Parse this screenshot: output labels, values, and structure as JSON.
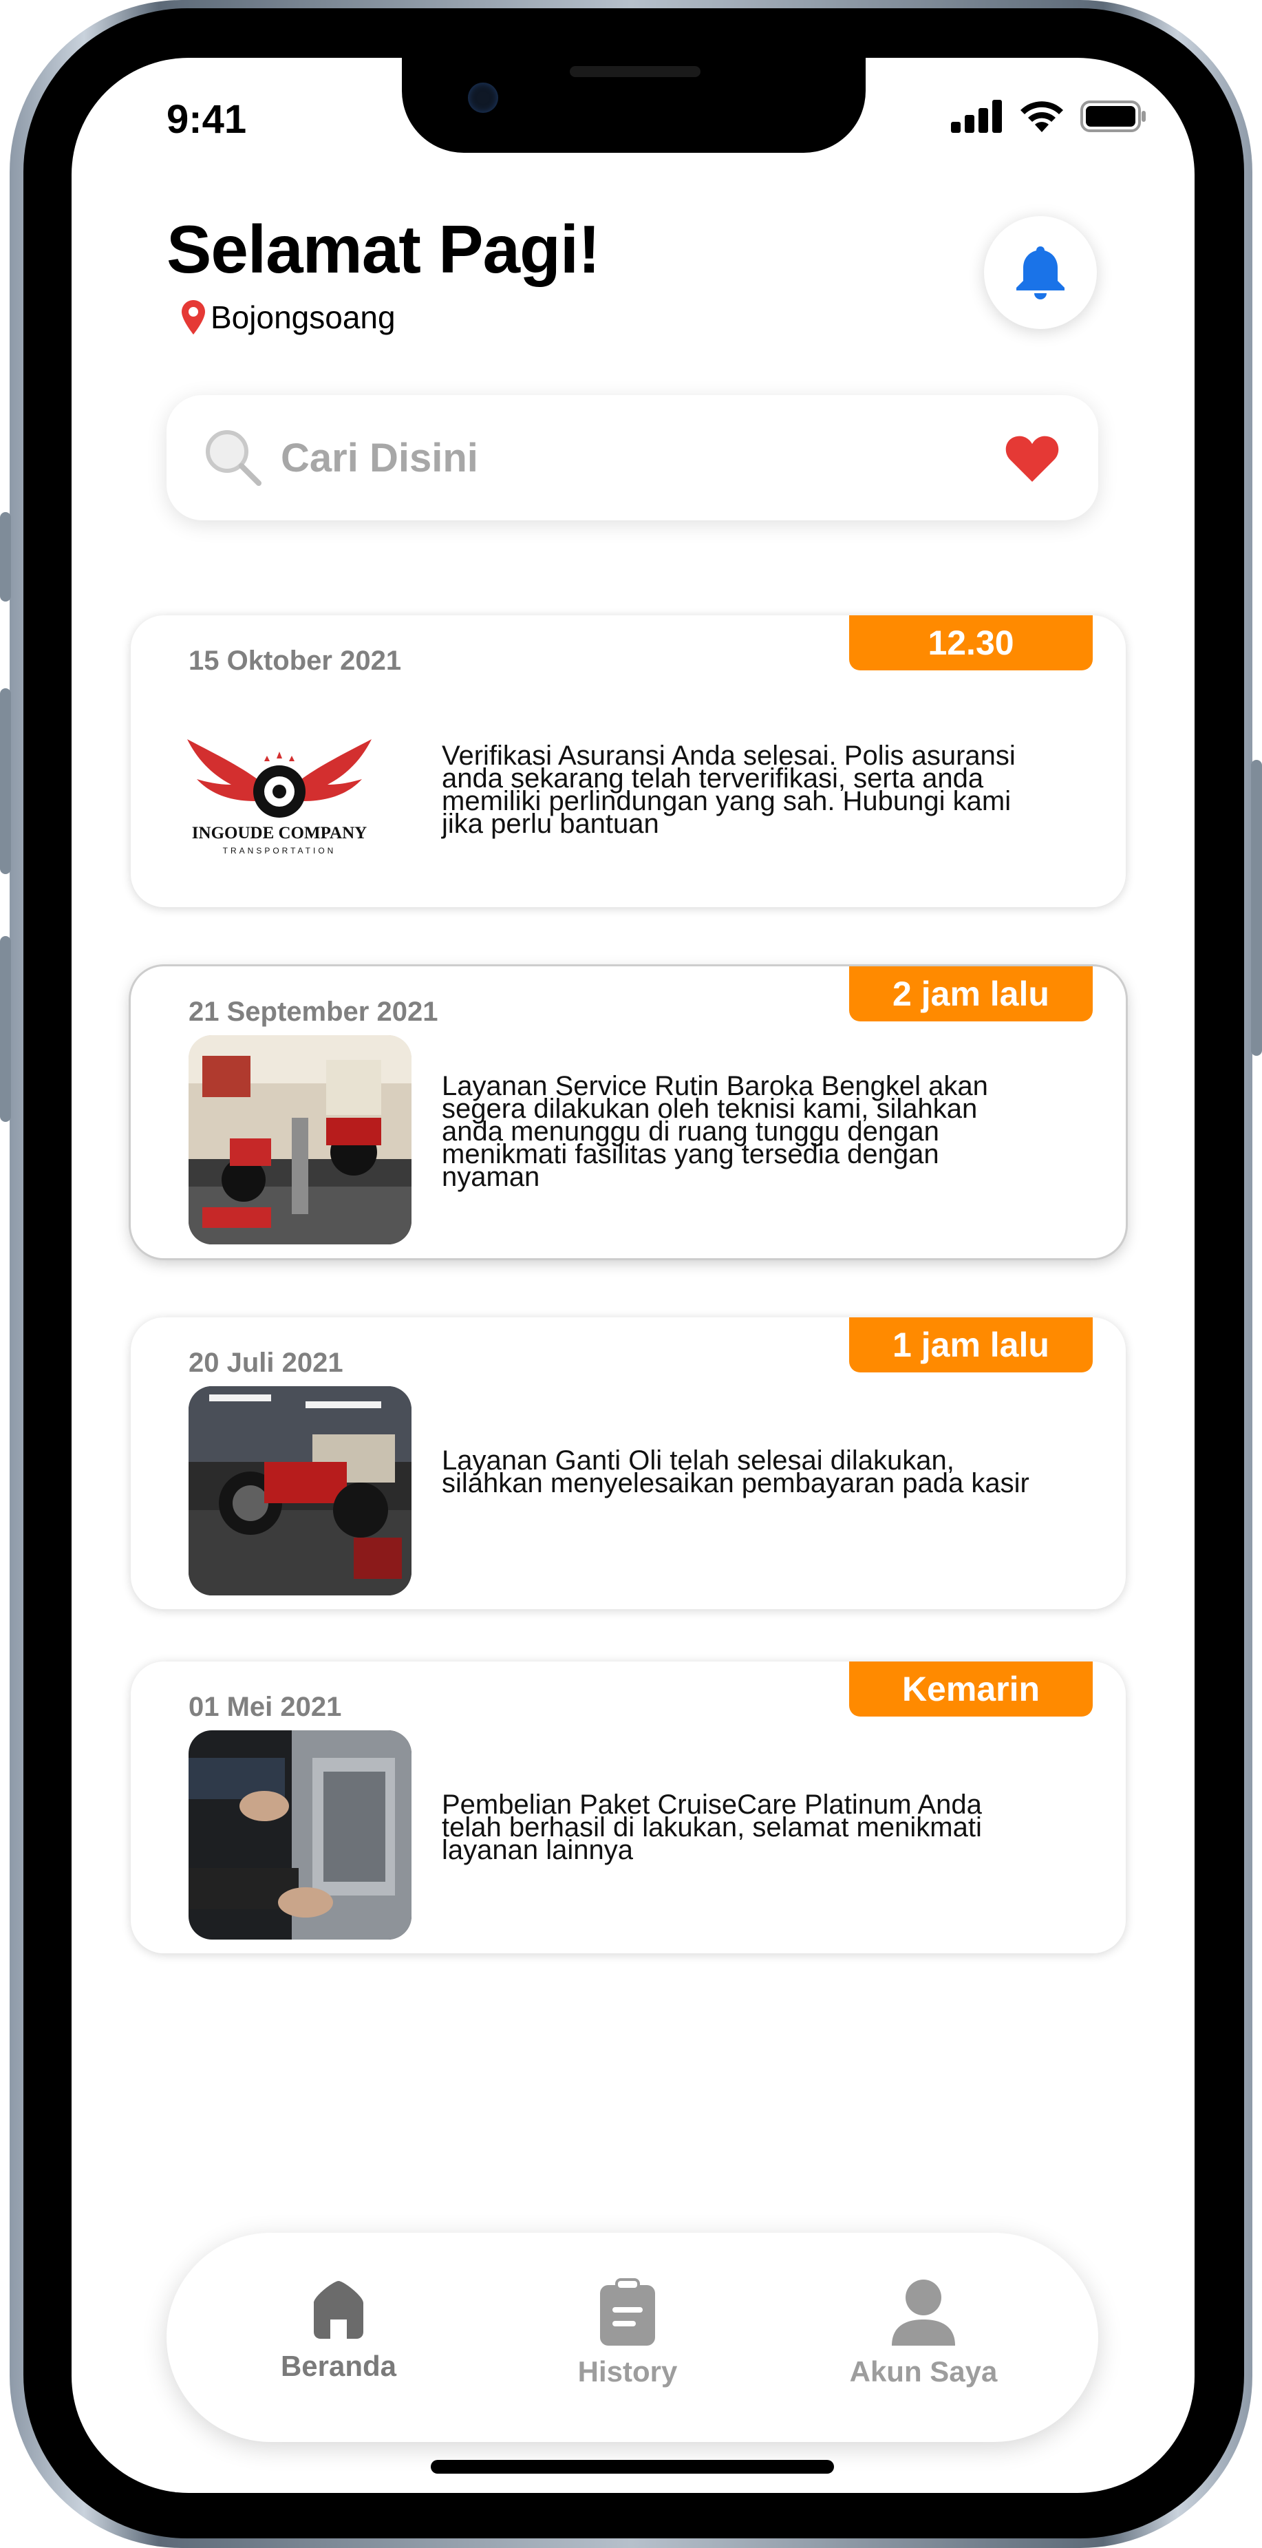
{
  "status_bar": {
    "time": "9:41"
  },
  "header": {
    "greeting": "Selamat Pagi!",
    "location": "Bojongsoang"
  },
  "search": {
    "placeholder": "Cari Disini"
  },
  "notifications": [
    {
      "date": "15 Oktober 2021",
      "badge": "12.30",
      "text": "Verifikasi Asuransi Anda selesai. Polis asuransi anda sekarang telah terverifikasi, serta anda memiliki perlindungan yang sah. Hubungi kami jika perlu bantuan",
      "logo_text": "INGOUDE COMPANY",
      "logo_subtext": "TRANSPORTATION"
    },
    {
      "date": "21 September 2021",
      "badge": "2 jam lalu",
      "text": "Layanan Service Rutin Baroka Bengkel akan segera dilakukan oleh teknisi kami, silahkan anda menunggu di ruang tunggu dengan menikmati fasilitas yang tersedia dengan nyaman"
    },
    {
      "date": "20 Juli 2021",
      "badge": "1 jam lalu",
      "text": "Layanan Ganti Oli telah selesai dilakukan, silahkan menyelesaikan pembayaran pada kasir"
    },
    {
      "date": "01 Mei 2021",
      "badge": "Kemarin",
      "text": "Pembelian Paket CruiseCare Platinum Anda telah berhasil di lakukan, selamat menikmati layanan lainnya"
    }
  ],
  "tabbar": {
    "tabs": [
      {
        "label": "Beranda",
        "icon": "home-icon"
      },
      {
        "label": "History",
        "icon": "clipboard-icon"
      },
      {
        "label": "Akun Saya",
        "icon": "user-icon"
      }
    ]
  },
  "colors": {
    "accent": "#ff8a00",
    "bell": "#1a73e8",
    "heart": "#e53935",
    "pin": "#e53935"
  }
}
